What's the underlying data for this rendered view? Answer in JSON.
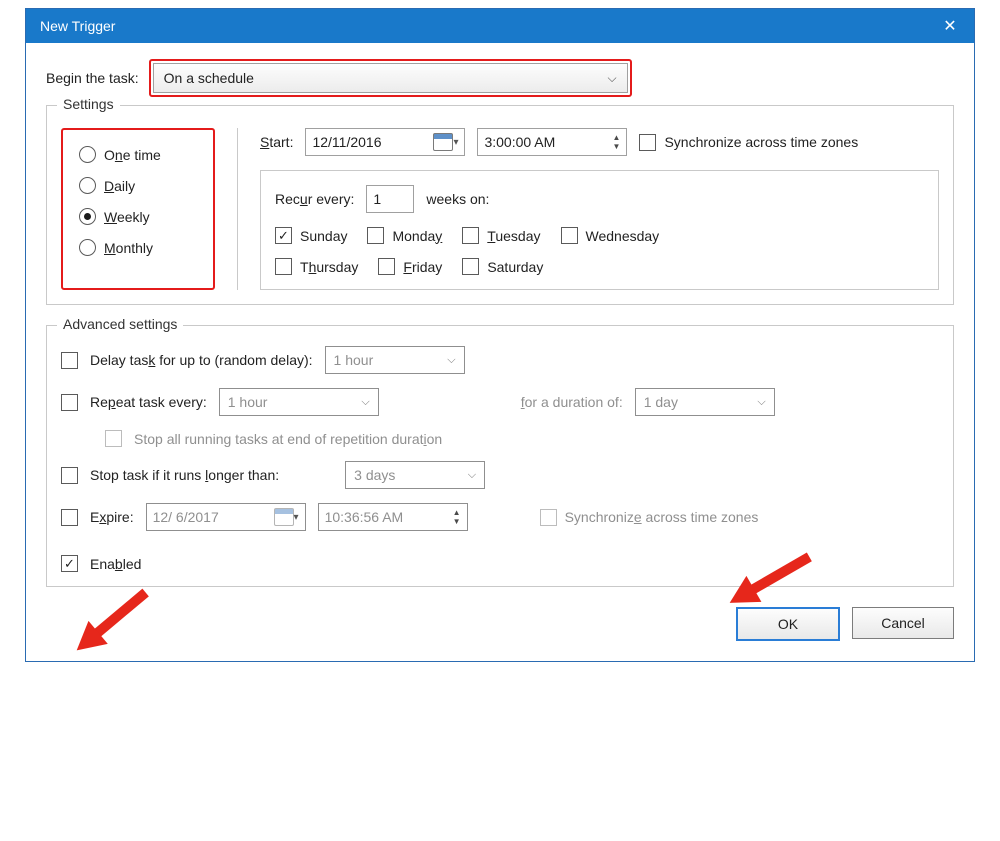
{
  "title": "New Trigger",
  "begin": {
    "label": "Begin the task:",
    "value": "On a schedule"
  },
  "settings": {
    "group_title": "Settings",
    "radios": {
      "one_time": "One time",
      "daily": "Daily",
      "weekly": "Weekly",
      "monthly": "Monthly",
      "selected": "weekly"
    },
    "start_label": "Start:",
    "start_date": "12/11/2016",
    "start_time": "3:00:00 AM",
    "sync_label": "Synchronize across time zones",
    "recur": {
      "label_pre": "Recur every:",
      "value": "1",
      "label_post": "weeks on:",
      "days": {
        "sunday": {
          "label": "Sunday",
          "checked": true
        },
        "monday": {
          "label": "Monday",
          "checked": false
        },
        "tuesday": {
          "label": "Tuesday",
          "checked": false
        },
        "wednesday": {
          "label": "Wednesday",
          "checked": false
        },
        "thursday": {
          "label": "Thursday",
          "checked": false
        },
        "friday": {
          "label": "Friday",
          "checked": false
        },
        "saturday": {
          "label": "Saturday",
          "checked": false
        }
      }
    }
  },
  "advanced": {
    "group_title": "Advanced settings",
    "delay_label": "Delay task for up to (random delay):",
    "delay_value": "1 hour",
    "repeat_label": "Repeat task every:",
    "repeat_value": "1 hour",
    "repeat_duration_label": "for a duration of:",
    "repeat_duration_value": "1 day",
    "stop_rep_label": "Stop all running tasks at end of repetition duration",
    "stop_long_label": "Stop task if it runs longer than:",
    "stop_long_value": "3 days",
    "expire_label": "Expire:",
    "expire_date": "12/ 6/2017",
    "expire_time": "10:36:56 AM",
    "expire_sync_label": "Synchronize across time zones",
    "enabled_label": "Enabled"
  },
  "buttons": {
    "ok": "OK",
    "cancel": "Cancel"
  }
}
